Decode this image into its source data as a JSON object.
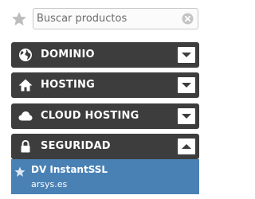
{
  "search": {
    "placeholder": "Buscar productos",
    "value": "",
    "favorite_icon": "star-icon",
    "clear_icon": "clear-icon"
  },
  "categories": [
    {
      "label": "DOMINIO",
      "icon": "globe-icon",
      "state": "collapsed"
    },
    {
      "label": "HOSTING",
      "icon": "house-icon",
      "state": "collapsed"
    },
    {
      "label": "CLOUD HOSTING",
      "icon": "cloud-icon",
      "state": "collapsed"
    },
    {
      "label": "SEGURIDAD",
      "icon": "lock-icon",
      "state": "expanded"
    }
  ],
  "products": [
    {
      "title": "DV InstantSSL",
      "domain": "arsys.es",
      "icon": "star-icon"
    }
  ],
  "colors": {
    "panel_bg": "#3d3d3d",
    "selected_bg": "#4a81b5"
  }
}
